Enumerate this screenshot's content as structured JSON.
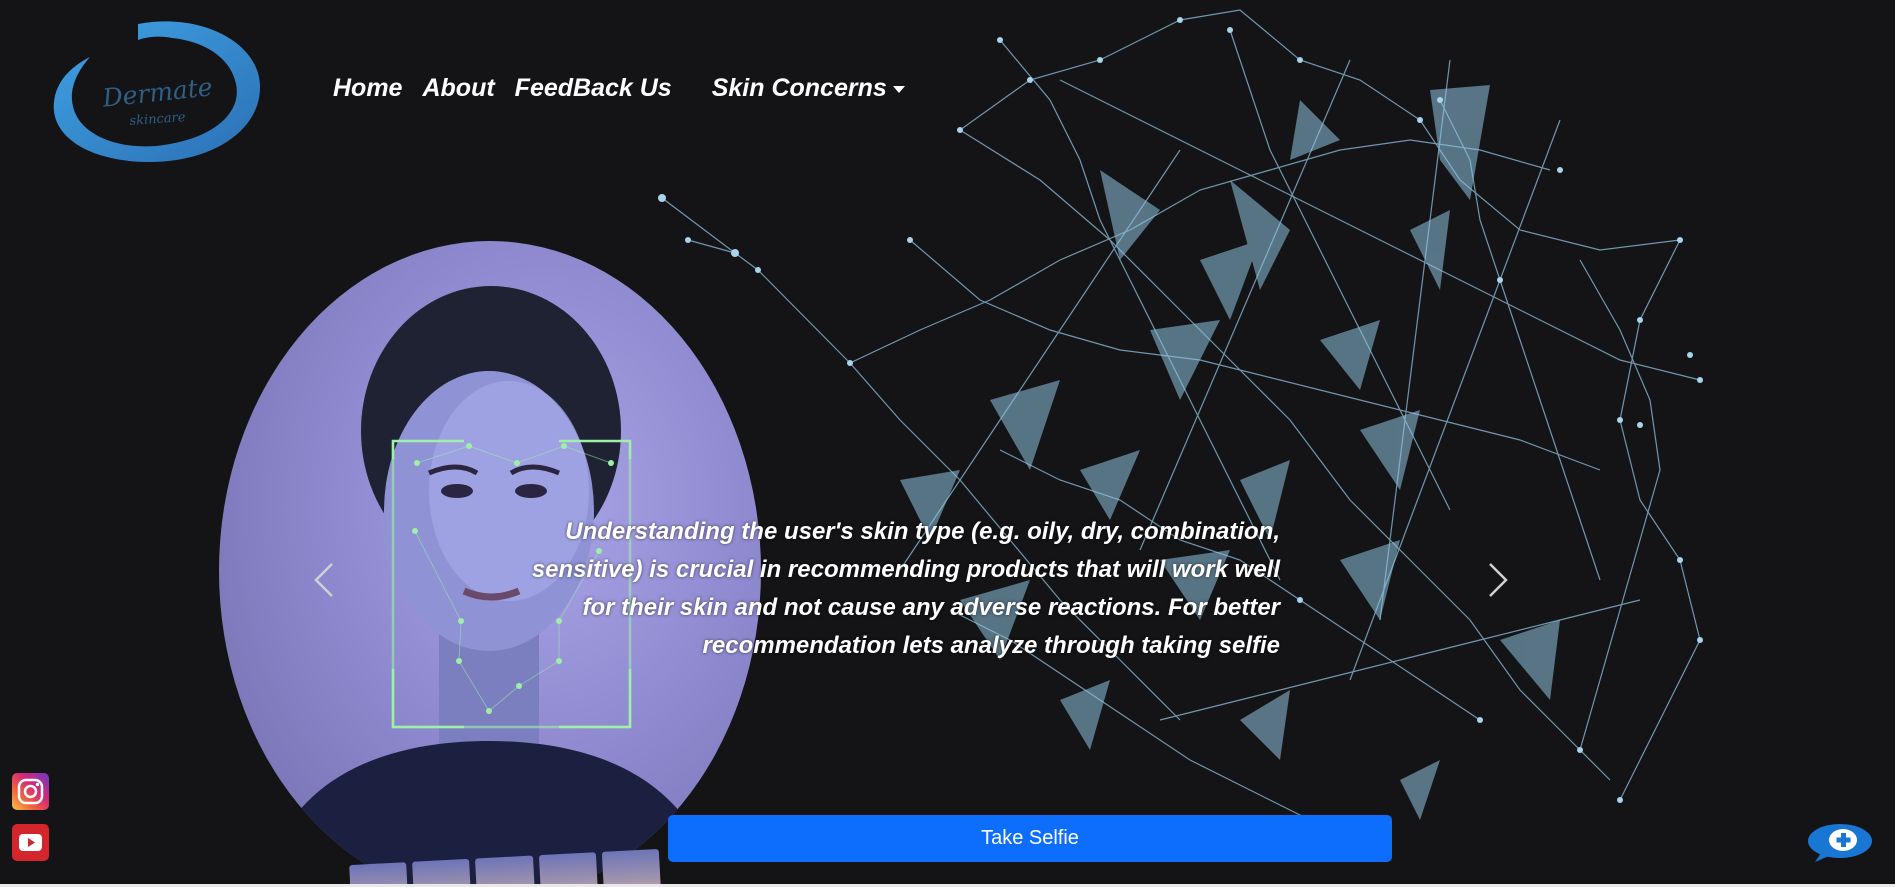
{
  "brand": {
    "name": "Dermate",
    "tagline": "skincare",
    "color": "#2e8bd0"
  },
  "nav": {
    "items": [
      {
        "label": "Home"
      },
      {
        "label": "About"
      },
      {
        "label": "FeedBack Us"
      }
    ],
    "dropdown_label": "Skin Concerns"
  },
  "hero": {
    "caption": "Understanding the user's skin type (e.g. oily, dry, combination, sensitive) is crucial in recommending products that will work well for their skin and not cause any adverse reactions. For better recommendation lets analyze through taking selfie",
    "cta_label": "Take Selfie",
    "cta_color": "#0d6efd",
    "prev_icon": "chevron-left-icon",
    "next_icon": "chevron-right-icon"
  },
  "social": {
    "instagram_icon": "instagram-icon",
    "youtube_icon": "youtube-icon"
  },
  "chat": {
    "icon": "chat-plus-icon",
    "color": "#1976d2"
  }
}
